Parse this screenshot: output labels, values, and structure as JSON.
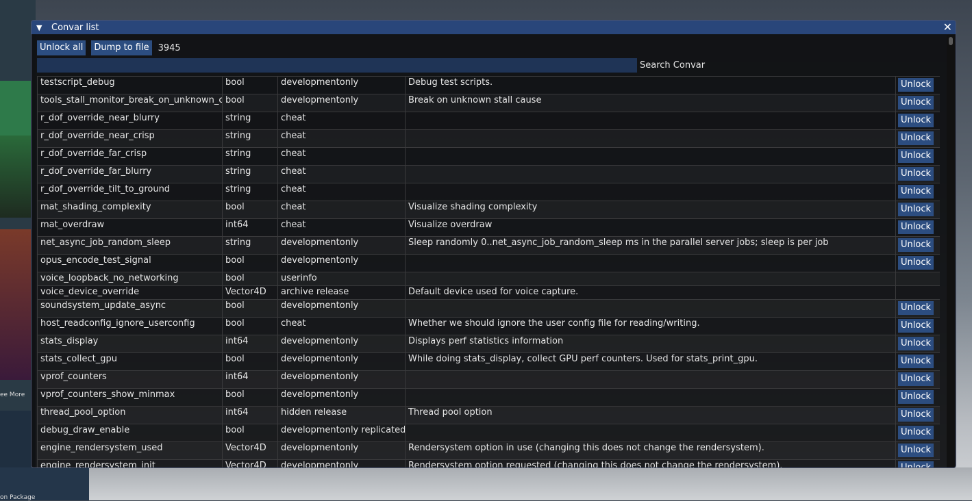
{
  "window": {
    "title": "Convar list",
    "collapse_glyph": "▼",
    "close_glyph": "✕"
  },
  "toolbar": {
    "unlock_all_label": "Unlock all",
    "dump_label": "Dump to file",
    "count": "3945"
  },
  "search": {
    "value": "",
    "label": "Search Convar"
  },
  "row_action_label": "Unlock",
  "rows": [
    {
      "name": "testscript_debug",
      "type": "bool",
      "flags": "developmentonly",
      "desc": "Debug test scripts.",
      "unlock": true
    },
    {
      "name": "tools_stall_monitor_break_on_unknown_cause",
      "type": "bool",
      "flags": "developmentonly",
      "desc": "Break on unknown stall cause",
      "unlock": true
    },
    {
      "name": "r_dof_override_near_blurry",
      "type": "string",
      "flags": "cheat",
      "desc": "",
      "unlock": true
    },
    {
      "name": "r_dof_override_near_crisp",
      "type": "string",
      "flags": "cheat",
      "desc": "",
      "unlock": true
    },
    {
      "name": "r_dof_override_far_crisp",
      "type": "string",
      "flags": "cheat",
      "desc": "",
      "unlock": true
    },
    {
      "name": "r_dof_override_far_blurry",
      "type": "string",
      "flags": "cheat",
      "desc": "",
      "unlock": true
    },
    {
      "name": "r_dof_override_tilt_to_ground",
      "type": "string",
      "flags": "cheat",
      "desc": "",
      "unlock": true
    },
    {
      "name": "mat_shading_complexity",
      "type": "bool",
      "flags": "cheat",
      "desc": "Visualize shading complexity",
      "unlock": true
    },
    {
      "name": "mat_overdraw",
      "type": "int64",
      "flags": "cheat",
      "desc": "Visualize overdraw",
      "unlock": true
    },
    {
      "name": "net_async_job_random_sleep",
      "type": "string",
      "flags": "developmentonly",
      "desc": "Sleep randomly 0..net_async_job_random_sleep ms in the parallel server jobs; sleep is per job",
      "unlock": true
    },
    {
      "name": "opus_encode_test_signal",
      "type": "bool",
      "flags": "developmentonly",
      "desc": "",
      "unlock": true
    },
    {
      "name": "voice_loopback_no_networking",
      "type": "bool",
      "flags": "userinfo",
      "desc": "",
      "unlock": false
    },
    {
      "name": "voice_device_override",
      "type": "Vector4D",
      "flags": "archive release",
      "desc": "Default device used for voice capture.",
      "unlock": false
    },
    {
      "name": "soundsystem_update_async",
      "type": "bool",
      "flags": "developmentonly",
      "desc": "",
      "unlock": true
    },
    {
      "name": "host_readconfig_ignore_userconfig",
      "type": "bool",
      "flags": "cheat",
      "desc": "Whether we should ignore the user config file for reading/writing.",
      "unlock": true
    },
    {
      "name": "stats_display",
      "type": "int64",
      "flags": "developmentonly",
      "desc": "Displays perf statistics information",
      "unlock": true
    },
    {
      "name": "stats_collect_gpu",
      "type": "bool",
      "flags": "developmentonly",
      "desc": "While doing stats_display, collect GPU perf counters. Used for stats_print_gpu.",
      "unlock": true
    },
    {
      "name": "vprof_counters",
      "type": "int64",
      "flags": "developmentonly",
      "desc": "",
      "unlock": true
    },
    {
      "name": "vprof_counters_show_minmax",
      "type": "bool",
      "flags": "developmentonly",
      "desc": "",
      "unlock": true
    },
    {
      "name": "thread_pool_option",
      "type": "int64",
      "flags": "hidden release",
      "desc": "Thread pool option",
      "unlock": true
    },
    {
      "name": "debug_draw_enable",
      "type": "bool",
      "flags": "developmentonly replicated",
      "desc": "",
      "unlock": true
    },
    {
      "name": "engine_rendersystem_used",
      "type": "Vector4D",
      "flags": "developmentonly",
      "desc": "Rendersystem option in use (changing this does not change the rendersystem).",
      "unlock": true
    },
    {
      "name": "engine_rendersystem_init",
      "type": "Vector4D",
      "flags": "developmentonly",
      "desc": "Rendersystem option requested (changing this does not change the rendersystem).",
      "unlock": true
    }
  ],
  "background": {
    "side_text_1": "ee More",
    "bottom_text": "on Package"
  }
}
